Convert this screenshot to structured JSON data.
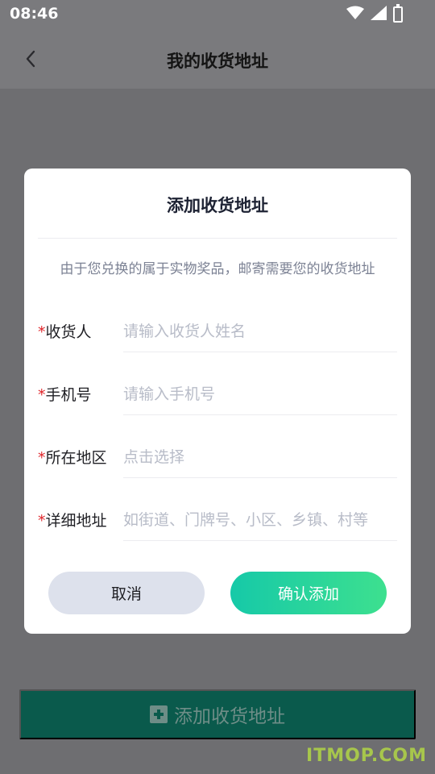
{
  "status_bar": {
    "time": "08:46"
  },
  "nav": {
    "title": "我的收货地址"
  },
  "dialog": {
    "title": "添加收货地址",
    "subtitle": "由于您兑换的属于实物奖品，邮寄需要您的收货地址",
    "fields": [
      {
        "label": "收货人",
        "placeholder": "请输入收货人姓名",
        "value": ""
      },
      {
        "label": "手机号",
        "placeholder": "请输入手机号",
        "value": ""
      },
      {
        "label": "所在地区",
        "placeholder": "点击选择",
        "value": ""
      },
      {
        "label": "详细地址",
        "placeholder": "如街道、门牌号、小区、乡镇、村等",
        "value": ""
      }
    ],
    "required_mark": "*",
    "cancel_label": "取消",
    "confirm_label": "确认添加"
  },
  "footer": {
    "add_address_label": "添加收货地址"
  },
  "watermark": "ITMOP.COM",
  "colors": {
    "accent_start": "#16c9a8",
    "accent_end": "#3de08f",
    "required": "#e0262b",
    "footer_button": "#0a5a4c"
  },
  "icons": [
    "wifi-icon",
    "cellular-signal-icon",
    "battery-icon",
    "back-arrow-icon",
    "plus-square-icon"
  ]
}
